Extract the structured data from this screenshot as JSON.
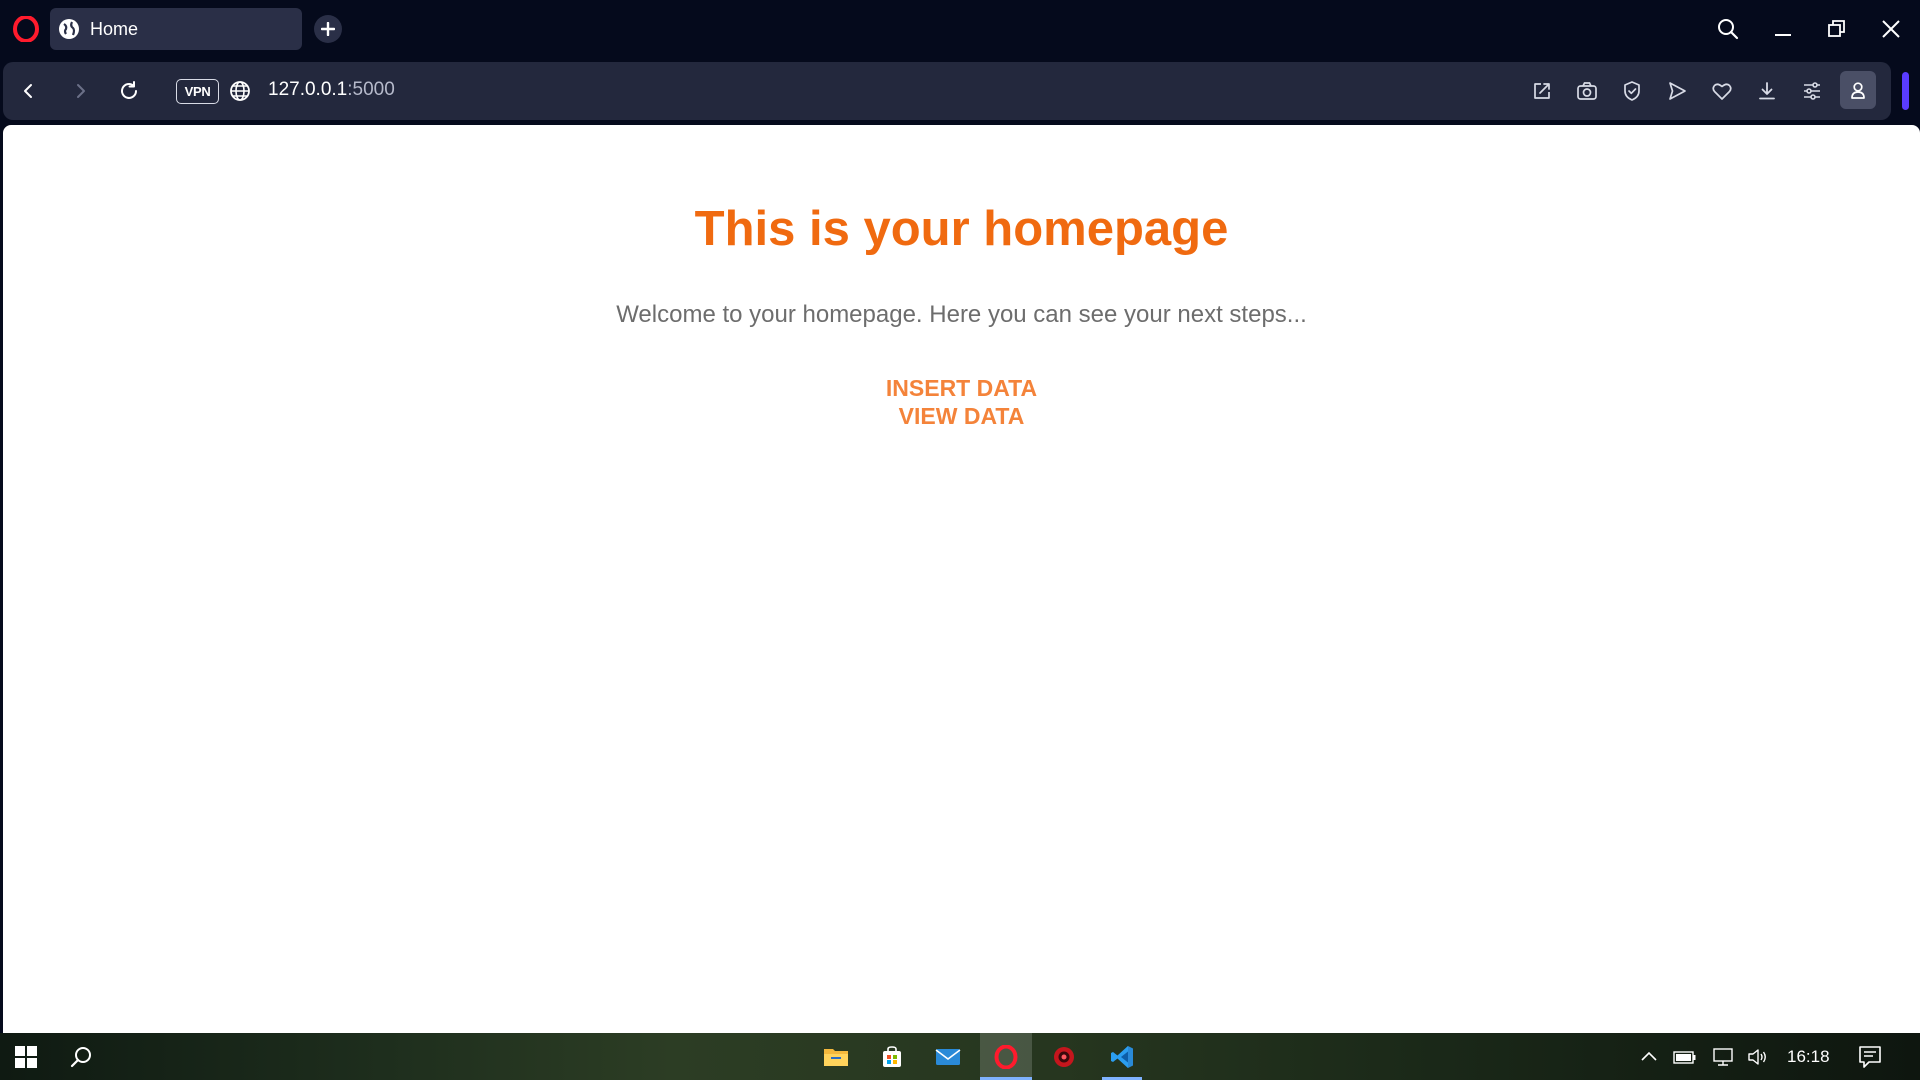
{
  "browser": {
    "name": "Opera",
    "tab": {
      "title": "Home",
      "icon": "globe-icon"
    },
    "new_tab_icon": "plus-icon",
    "window_controls": [
      "search-icon",
      "minimize-icon",
      "restore-icon",
      "close-icon"
    ],
    "address": {
      "vpn_label": "VPN",
      "host": "127.0.0.1",
      "port": ":5000"
    },
    "toolbar_icons": [
      "share-icon",
      "camera-icon",
      "shield-icon",
      "send-icon",
      "heart-icon",
      "download-icon",
      "easy-setup-icon",
      "profile-icon"
    ],
    "accent_color": "#5a3cff"
  },
  "page": {
    "headline": "This is your homepage",
    "subtitle": "Welcome to your homepage. Here you can see your next steps...",
    "links": [
      {
        "label": "INSERT DATA"
      },
      {
        "label": "VIEW DATA"
      }
    ],
    "headline_color": "#f06a10",
    "link_color": "#f4833a"
  },
  "taskbar": {
    "apps": [
      "file-explorer-icon",
      "store-icon",
      "mail-icon",
      "opera-icon",
      "app-red-icon",
      "vscode-icon"
    ],
    "tray_icons": [
      "chevron-up-icon",
      "battery-icon",
      "network-icon",
      "volume-icon"
    ],
    "time": "16:18",
    "notification_icon": "notification-icon"
  }
}
